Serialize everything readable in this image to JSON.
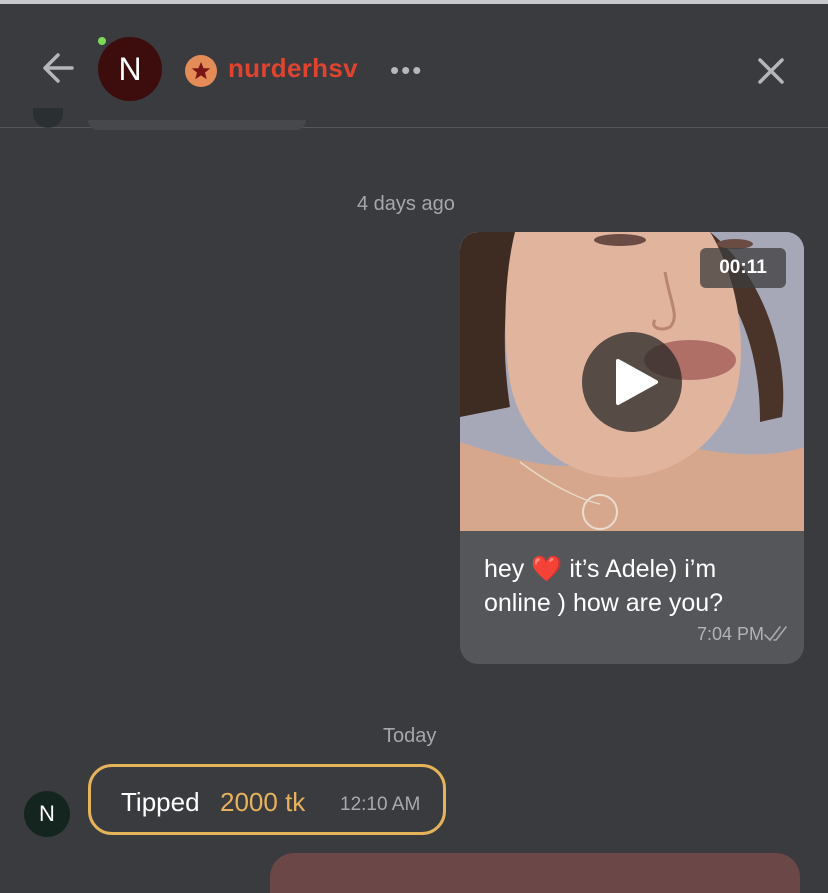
{
  "header": {
    "avatar_initial": "N",
    "username": "nurderhsv",
    "more_label": "•••",
    "online": true,
    "colors": {
      "username": "#e0432e",
      "badge": "#e48c57",
      "online": "#7ed957"
    }
  },
  "timeline": {
    "divider_1": "4 days ago",
    "divider_2": "Today"
  },
  "messages": [
    {
      "type": "video",
      "duration": "00:11",
      "text_before_emoji": "hey ",
      "emoji": "❤️",
      "text_after_emoji": " it’s Adele) i’m online ) how are you?",
      "time": "7:04 PM",
      "status": "read"
    },
    {
      "type": "tip",
      "avatar_initial": "N",
      "label": "Tipped",
      "amount": "2000 tk",
      "time": "12:10 AM",
      "accent": "#e4b35a"
    }
  ]
}
